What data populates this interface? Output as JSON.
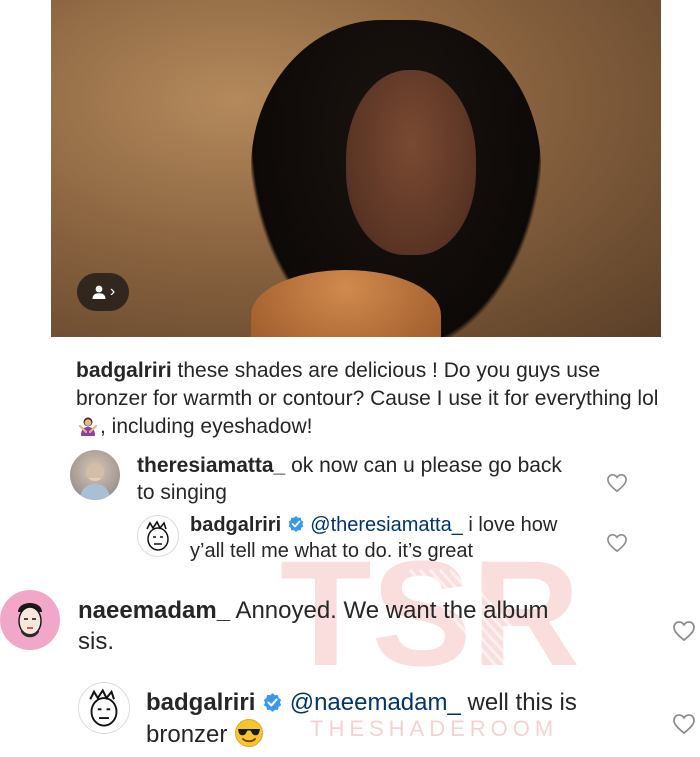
{
  "post": {
    "tag_badge_icon": "person-icon",
    "tag_badge_chevron": "›"
  },
  "caption": {
    "username": "badgalriri",
    "text_part1": " these shades are delicious ! Do you guys use bronzer for warmth or contour? Cause I use it for everything lol ",
    "emoji": "woman-gesturing-no-emoji",
    "text_part2": ", including eyeshadow!"
  },
  "comments": [
    {
      "username": "theresiamatta_",
      "text": " ok now can u please go back to singing"
    },
    {
      "username": "badgalriri",
      "verified": true,
      "mention": "@theresiamatta_",
      "text": " i love how y’all tell me what to do. it’s great"
    },
    {
      "username": "naeemadam_",
      "text": " Annoyed. We want the album sis."
    },
    {
      "username": "badgalriri",
      "verified": true,
      "mention": "@naeemadam_",
      "text": " well this is bronzer",
      "emoji": "smiling-face-with-sunglasses-emoji"
    }
  ],
  "watermark": {
    "logo": "TSR",
    "text": "THESHADEROOM"
  },
  "colors": {
    "mention": "#003569",
    "verified": "#3897f0",
    "heart_stroke": "#8e8e8e"
  }
}
